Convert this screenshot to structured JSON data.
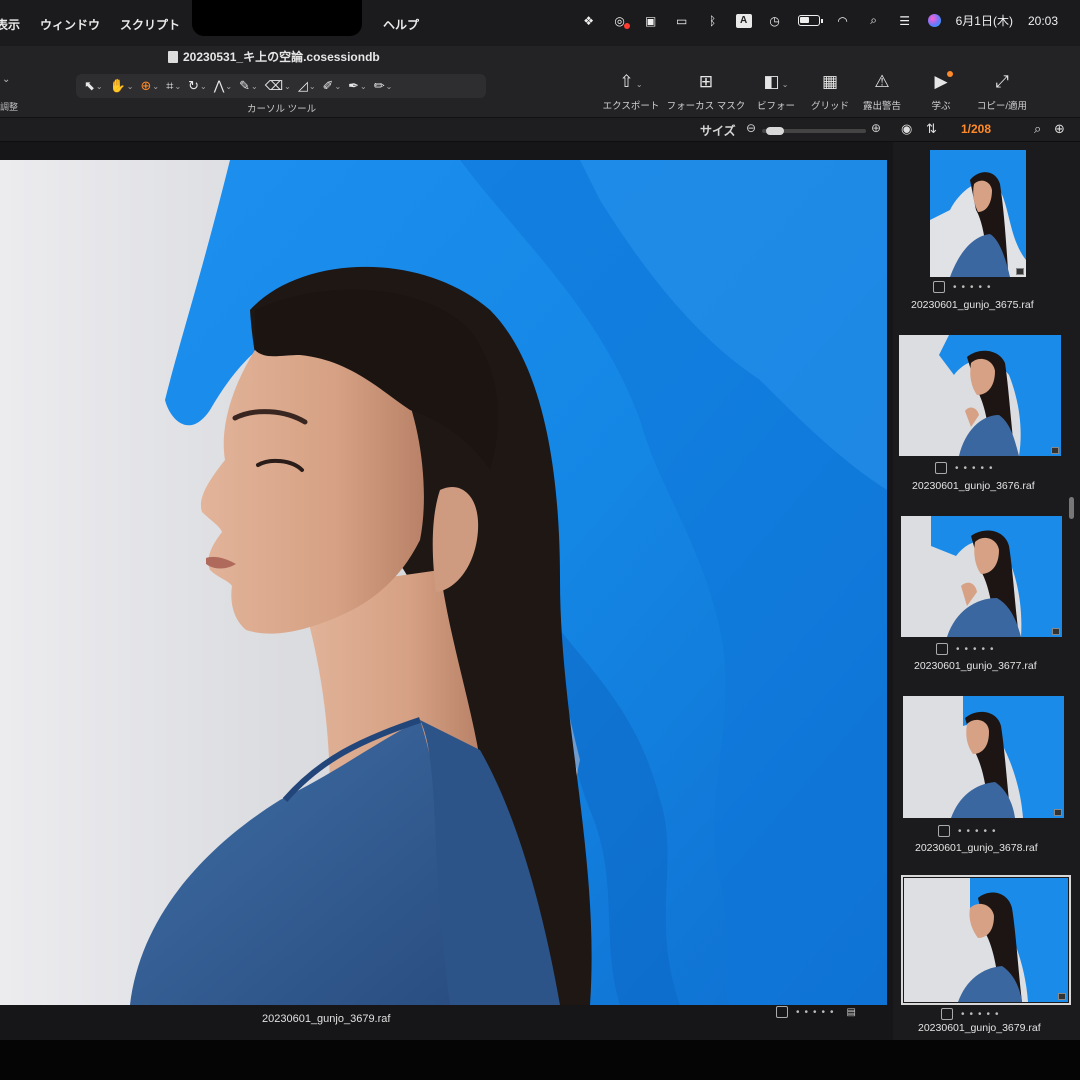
{
  "menubar": {
    "items": [
      "表示",
      "ウィンドウ",
      "スクリプト"
    ],
    "help": "ヘルプ",
    "date": "6月1日(木)",
    "time": "20:03"
  },
  "window": {
    "title": "20230531_キ上の空論.cosessiondb"
  },
  "toolbar": {
    "left_label": "調整",
    "cursor_tools_label": "カーソル ツール",
    "buttons": [
      {
        "label": "エクスポート",
        "icon": "export-icon"
      },
      {
        "label": "フォーカス マスク",
        "icon": "focus-mask-icon"
      },
      {
        "label": "ビフォー",
        "icon": "before-icon"
      },
      {
        "label": "グリッド",
        "icon": "grid-icon"
      },
      {
        "label": "露出警告",
        "icon": "exposure-warning-icon"
      },
      {
        "label": "学ぶ",
        "icon": "learn-icon"
      },
      {
        "label": "コピー/適用",
        "icon": "copy-apply-icon"
      }
    ]
  },
  "subbar": {
    "size_label": "サイズ",
    "counter": "1/208",
    "size_slider_value": 0.05
  },
  "viewer": {
    "filename": "20230601_gunjo_3679.raf"
  },
  "browser": {
    "thumbnails": [
      {
        "name": "20230601_gunjo_3675.raf",
        "orientation": "portrait",
        "selected": false
      },
      {
        "name": "20230601_gunjo_3676.raf",
        "orientation": "landscape",
        "selected": false
      },
      {
        "name": "20230601_gunjo_3677.raf",
        "orientation": "landscape",
        "selected": false
      },
      {
        "name": "20230601_gunjo_3678.raf",
        "orientation": "landscape",
        "selected": false
      },
      {
        "name": "20230601_gunjo_3679.raf",
        "orientation": "landscape",
        "selected": true
      }
    ]
  },
  "colors": {
    "accent": "#ff8a2a",
    "fabric_blue": "#1b8fe8",
    "jacket_blue": "#345f98"
  }
}
